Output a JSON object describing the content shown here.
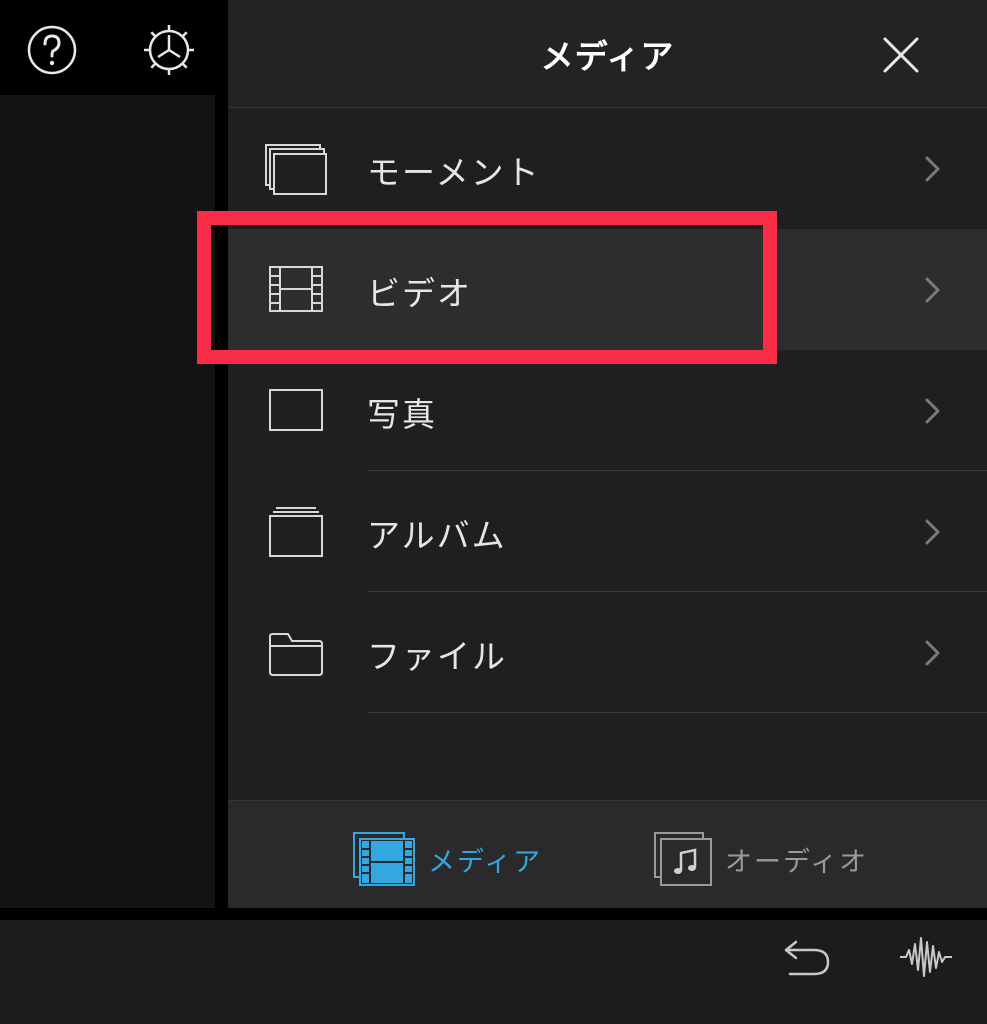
{
  "panel": {
    "title": "メディア"
  },
  "list": {
    "items": [
      {
        "label": "モーメント",
        "icon": "moments-icon"
      },
      {
        "label": "ビデオ",
        "icon": "video-film-icon",
        "selected": true
      },
      {
        "label": "写真",
        "icon": "photo-icon"
      },
      {
        "label": "アルバム",
        "icon": "album-icon"
      },
      {
        "label": "ファイル",
        "icon": "folder-icon"
      }
    ]
  },
  "tabs": {
    "media_label": "メディア",
    "audio_label": "オーディオ"
  },
  "colors": {
    "accent": "#35a7e0",
    "highlight": "#fa2d48",
    "panel_bg": "#1f1f21",
    "text": "#e6e6e6"
  },
  "icons": [
    "help-icon",
    "settings-gear-icon",
    "close-icon",
    "chevron-right-icon",
    "undo-icon",
    "audio-waveform-icon"
  ]
}
